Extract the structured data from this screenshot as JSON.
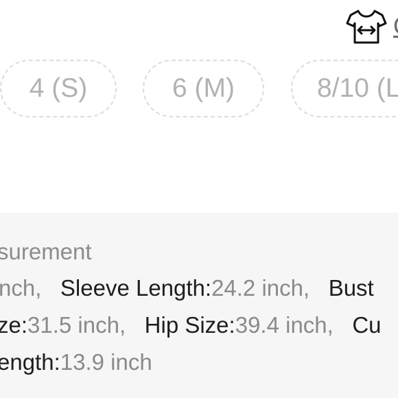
{
  "size_guide": {
    "icon": "tshirt-width-icon",
    "label": "G"
  },
  "sizes": [
    {
      "label": "4 (S)",
      "available": false
    },
    {
      "label": "6 (M)",
      "available": false
    },
    {
      "label": "8/10 (L",
      "available": false
    }
  ],
  "measurement": {
    "title": "surement",
    "line1": {
      "frag_value": "nch,",
      "sleeve_key": "Sleeve Length:",
      "sleeve_value": "24.2 inch,",
      "bust_key": "Bust"
    },
    "line2": {
      "frag_key": "ze:",
      "frag_value": "31.5 inch,",
      "hip_key": "Hip Size:",
      "hip_value": "39.4 inch,",
      "cuff_key": "Cu"
    },
    "line3": {
      "frag_key": "ength:",
      "frag_value": "13.9 inch"
    }
  },
  "colors": {
    "chip_border": "#dcdcdc",
    "chip_text": "#b2b2b2",
    "panel_bg": "#f6f6f6",
    "key_text": "#1e1e1e",
    "value_text": "#8a8a8a"
  }
}
